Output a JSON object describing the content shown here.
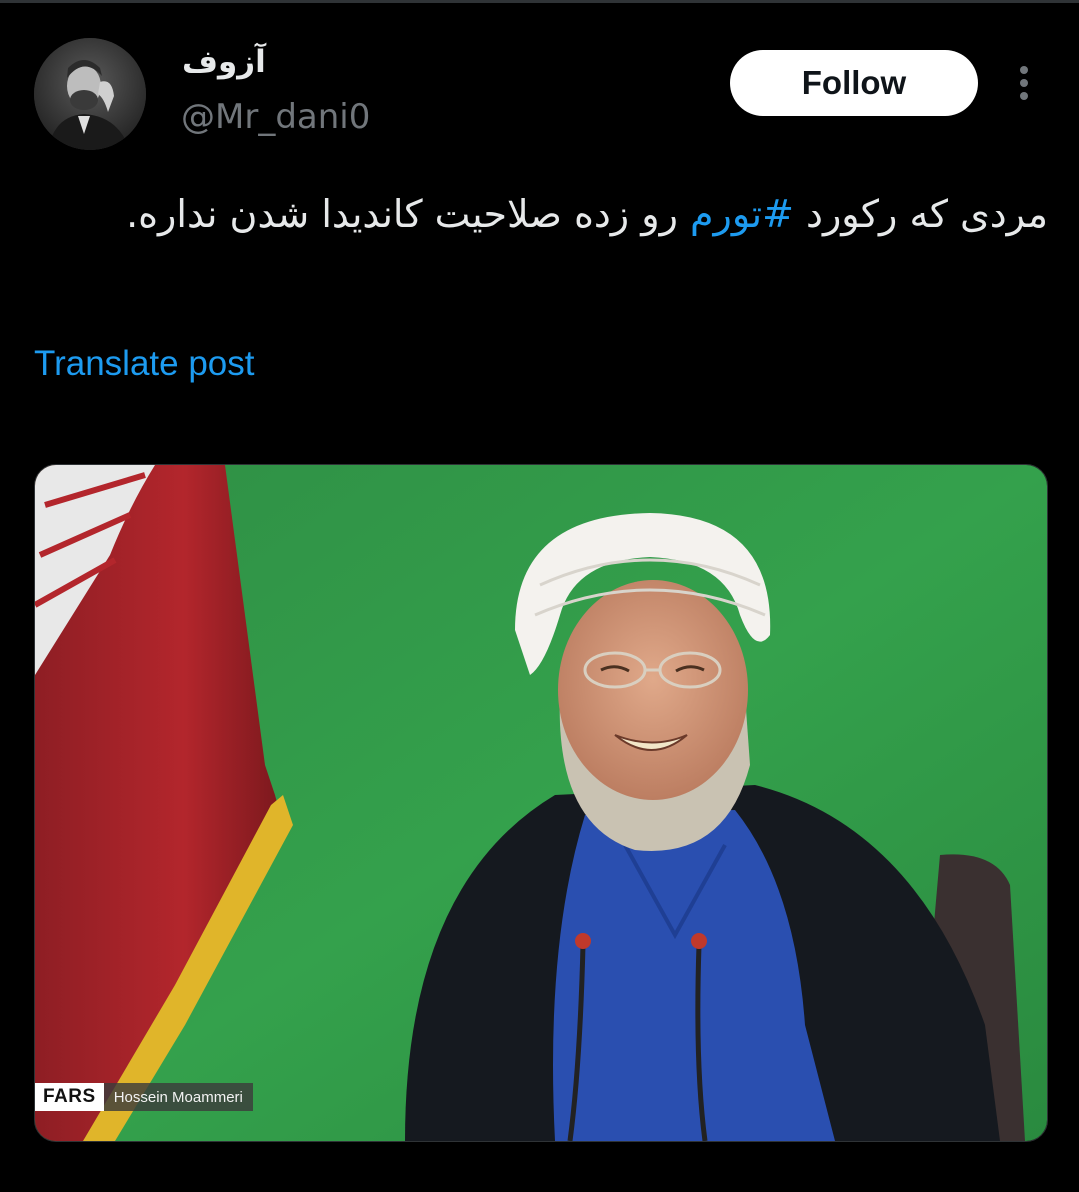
{
  "author": {
    "display_name": "آزوف",
    "handle": "@Mr_dani0",
    "avatar_icon": "avatar-portrait-icon"
  },
  "actions": {
    "follow_label": "Follow",
    "more_icon": "more-options-icon"
  },
  "post": {
    "text_before": "مردی که رکورد ",
    "hashtag": "#تورم",
    "text_after": " رو زده صلاحیت کاندیدا شدن نداره.",
    "translate_label": "Translate post"
  },
  "media": {
    "credit_logo": "FARS",
    "credit_name": "Hossein Moammeri"
  },
  "colors": {
    "background": "#000000",
    "text": "#e7e9ea",
    "secondary_text": "#71767b",
    "accent": "#1d9bf0",
    "follow_bg": "#ffffff"
  }
}
